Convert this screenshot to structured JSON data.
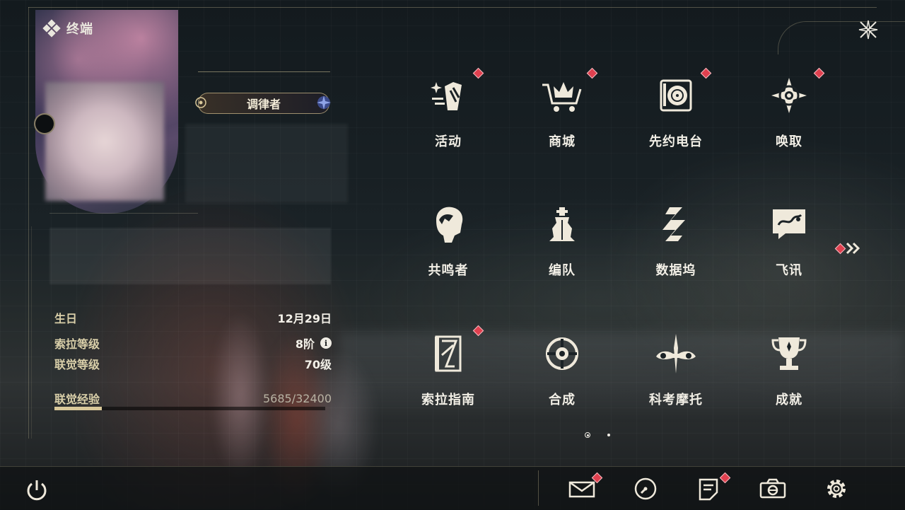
{
  "header": {
    "title": "终端"
  },
  "profile": {
    "title_badge": "调律者",
    "stats": [
      {
        "label": "生日",
        "value": "12月29日"
      },
      {
        "label": "索拉等级",
        "value": "8阶"
      },
      {
        "label": "联觉等级",
        "value": "70级"
      }
    ],
    "exp": {
      "label": "联觉经验",
      "value": "5685/32400",
      "progress": 0.175
    }
  },
  "menu": {
    "items": [
      {
        "label": "活动",
        "icon": "activity-icon",
        "badge": true
      },
      {
        "label": "商城",
        "icon": "shop-cart-icon",
        "badge": true
      },
      {
        "label": "先约电台",
        "icon": "radio-icon",
        "badge": true
      },
      {
        "label": "唤取",
        "icon": "summon-compass-icon",
        "badge": true
      },
      {
        "label": "共鸣者",
        "icon": "resonator-icon",
        "badge": false
      },
      {
        "label": "编队",
        "icon": "team-chess-icon",
        "badge": false
      },
      {
        "label": "数据坞",
        "icon": "data-bank-icon",
        "badge": false
      },
      {
        "label": "飞讯",
        "icon": "message-icon",
        "badge": false
      },
      {
        "label": "索拉指南",
        "icon": "guide-book-icon",
        "badge": true
      },
      {
        "label": "合成",
        "icon": "synthesis-icon",
        "badge": false
      },
      {
        "label": "科考摩托",
        "icon": "motorcycle-icon",
        "badge": false
      },
      {
        "label": "成就",
        "icon": "trophy-icon",
        "badge": false
      }
    ],
    "page_count": 2,
    "current_page": 1
  },
  "colors": {
    "badge_red": "#e0404f",
    "accent_gold": "#d9c89a"
  }
}
